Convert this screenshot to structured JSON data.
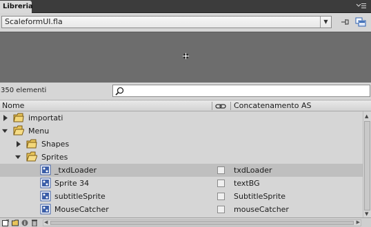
{
  "panel": {
    "tab_label": "Libreria",
    "menu_icon": "panel-menu-icon"
  },
  "toolbar": {
    "document": "ScaleformUI.fla",
    "pin_icon": "pin-icon",
    "new_library_icon": "new-library-icon"
  },
  "search": {
    "count_label": "350 elementi",
    "placeholder": ""
  },
  "columns": {
    "name": "Nome",
    "linkage_icon": "link-icon",
    "as_linkage": "Concatenamento AS"
  },
  "rows": [
    {
      "type": "folder",
      "label": "importati",
      "expanded": false,
      "level": 0
    },
    {
      "type": "folder",
      "label": "Menu",
      "expanded": true,
      "level": 0
    },
    {
      "type": "folder",
      "label": "Shapes",
      "expanded": false,
      "level": 1
    },
    {
      "type": "folder",
      "label": "Sprites",
      "expanded": true,
      "level": 1
    },
    {
      "type": "symbol",
      "label": "_txdLoader",
      "as": "txdLoader",
      "selected": true,
      "level": 2
    },
    {
      "type": "symbol",
      "label": "Sprite 34",
      "as": "textBG",
      "level": 2
    },
    {
      "type": "symbol",
      "label": "subtitleSprite",
      "as": "SubtitleSprite",
      "level": 2
    },
    {
      "type": "symbol",
      "label": "MouseCatcher",
      "as": "mouseCatcher",
      "level": 2
    }
  ],
  "footer": {
    "icons": [
      "new-symbol-icon",
      "new-folder-icon",
      "properties-icon",
      "delete-icon"
    ]
  },
  "colors": {
    "folder": "#e8c45a",
    "symbol_icon": "#3b5ea8",
    "selected_row": "#bfbfbf",
    "preview_bg": "#6d6d6d"
  }
}
